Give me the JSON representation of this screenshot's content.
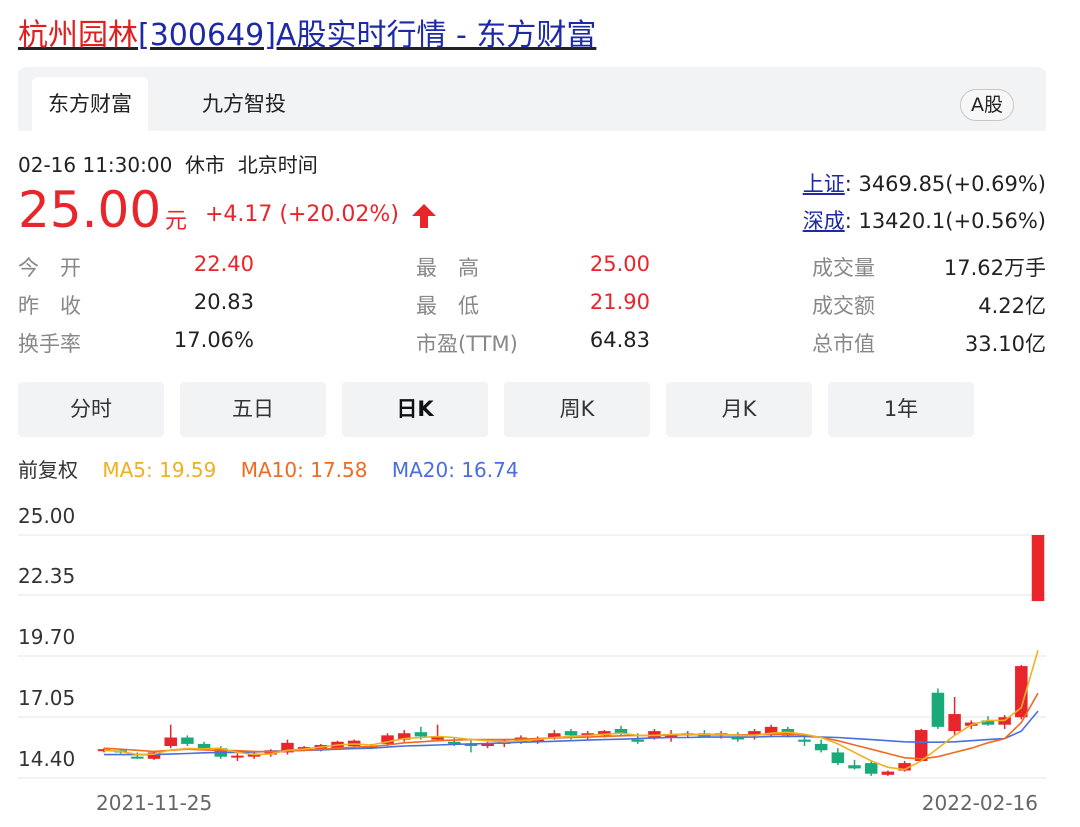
{
  "page": {
    "title_name": "杭州园林",
    "title_rest": "[300649]A股实时行情 - 东方财富"
  },
  "tabs": [
    {
      "label": "东方财富",
      "active": true
    },
    {
      "label": "九方智投",
      "active": false
    }
  ],
  "market_badge": "A股",
  "quote": {
    "time": "02-16 11:30:00",
    "status": "休市",
    "timezone": "北京时间",
    "price": "25.00",
    "unit": "元",
    "change": "+4.17 (+20.02%)",
    "direction_icon": "up-arrow-icon"
  },
  "indices": [
    {
      "label": "上证",
      "value": ": 3469.85(+0.69%)"
    },
    {
      "label": "深成",
      "value": ": 13420.1(+0.56%)"
    }
  ],
  "stats": [
    {
      "label": "今　开",
      "value": "22.40",
      "color": "red"
    },
    {
      "label": "最　高",
      "value": "25.00",
      "color": "red"
    },
    {
      "label": "成交量",
      "value": "17.62万手",
      "color": "dark"
    },
    {
      "label": "昨　收",
      "value": "20.83",
      "color": "dark"
    },
    {
      "label": "最　低",
      "value": "21.90",
      "color": "red"
    },
    {
      "label": "成交额",
      "value": "4.22亿",
      "color": "dark"
    },
    {
      "label": "换手率",
      "value": "17.06%",
      "color": "dark"
    },
    {
      "label": "市盈(TTM)",
      "value": "64.83",
      "color": "dark"
    },
    {
      "label": "总市值",
      "value": "33.10亿",
      "color": "dark"
    }
  ],
  "period_tabs": [
    {
      "label": "分时",
      "active": false
    },
    {
      "label": "五日",
      "active": false
    },
    {
      "label": "日K",
      "active": true
    },
    {
      "label": "周K",
      "active": false
    },
    {
      "label": "月K",
      "active": false
    },
    {
      "label": "1年",
      "active": false
    }
  ],
  "ma": {
    "adjust": "前复权",
    "ma5": "MA5: 19.59",
    "ma10": "MA10: 17.58",
    "ma20": "MA20: 16.74"
  },
  "colors": {
    "up": "#e8252a",
    "down": "#1aaa7a",
    "ma5": "#f0b020",
    "ma10": "#f06a20",
    "ma20": "#4a6ee0",
    "link": "#1d2aa8"
  },
  "chart_data": {
    "type": "candlestick",
    "y_ticks": [
      "25.00",
      "22.35",
      "19.70",
      "17.05",
      "14.40"
    ],
    "ylim": [
      13.6,
      25.0
    ],
    "x_labels": [
      "2021-11-25",
      "2022-02-16"
    ],
    "grid": true,
    "candles": [
      [
        14.9,
        15.0,
        14.8,
        14.95
      ],
      [
        14.9,
        14.95,
        14.75,
        14.8
      ],
      [
        14.6,
        14.8,
        14.5,
        14.55
      ],
      [
        14.5,
        14.85,
        14.45,
        14.8
      ],
      [
        15.1,
        16.1,
        15.0,
        15.5
      ],
      [
        15.5,
        15.6,
        15.1,
        15.2
      ],
      [
        15.2,
        15.3,
        14.9,
        15.0
      ],
      [
        15.0,
        15.1,
        14.5,
        14.6
      ],
      [
        14.6,
        14.75,
        14.4,
        14.65
      ],
      [
        14.6,
        14.8,
        14.5,
        14.75
      ],
      [
        14.7,
        14.95,
        14.6,
        14.9
      ],
      [
        14.8,
        15.4,
        14.7,
        15.25
      ],
      [
        14.95,
        15.1,
        14.85,
        15.05
      ],
      [
        14.9,
        15.2,
        14.85,
        15.15
      ],
      [
        15.0,
        15.35,
        14.95,
        15.3
      ],
      [
        15.1,
        15.4,
        15.05,
        15.35
      ],
      [
        15.0,
        15.2,
        14.95,
        15.1
      ],
      [
        15.2,
        15.7,
        15.1,
        15.6
      ],
      [
        15.4,
        15.85,
        15.3,
        15.7
      ],
      [
        15.75,
        16.0,
        15.4,
        15.55
      ],
      [
        15.4,
        16.1,
        15.35,
        15.5
      ],
      [
        15.3,
        15.5,
        15.1,
        15.25
      ],
      [
        15.2,
        15.45,
        14.8,
        15.1
      ],
      [
        15.1,
        15.3,
        15.0,
        15.2
      ],
      [
        15.2,
        15.4,
        15.05,
        15.35
      ],
      [
        15.3,
        15.6,
        15.2,
        15.5
      ],
      [
        15.3,
        15.55,
        15.2,
        15.45
      ],
      [
        15.5,
        15.85,
        15.4,
        15.7
      ],
      [
        15.8,
        15.9,
        15.4,
        15.6
      ],
      [
        15.6,
        15.8,
        15.4,
        15.7
      ],
      [
        15.6,
        15.85,
        15.5,
        15.8
      ],
      [
        15.9,
        16.05,
        15.6,
        15.7
      ],
      [
        15.4,
        15.7,
        15.2,
        15.3
      ],
      [
        15.5,
        15.9,
        15.4,
        15.8
      ],
      [
        15.5,
        15.85,
        15.3,
        15.6
      ],
      [
        15.6,
        15.8,
        15.5,
        15.7
      ],
      [
        15.7,
        15.85,
        15.5,
        15.55
      ],
      [
        15.6,
        15.8,
        15.45,
        15.7
      ],
      [
        15.5,
        15.75,
        15.3,
        15.45
      ],
      [
        15.6,
        15.9,
        15.4,
        15.8
      ],
      [
        15.7,
        16.1,
        15.5,
        16.0
      ],
      [
        15.9,
        16.0,
        15.5,
        15.6
      ],
      [
        15.4,
        15.6,
        15.1,
        15.3
      ],
      [
        15.2,
        15.4,
        14.8,
        14.9
      ],
      [
        14.8,
        15.0,
        14.2,
        14.3
      ],
      [
        14.2,
        14.45,
        14.0,
        14.05
      ],
      [
        14.3,
        14.4,
        13.7,
        13.8
      ],
      [
        13.75,
        13.95,
        13.7,
        13.9
      ],
      [
        13.95,
        14.4,
        13.9,
        14.3
      ],
      [
        14.4,
        15.9,
        14.4,
        15.85
      ],
      [
        17.6,
        17.8,
        15.9,
        16.0
      ],
      [
        15.8,
        17.4,
        15.6,
        16.6
      ],
      [
        16.05,
        16.3,
        15.9,
        16.2
      ],
      [
        16.3,
        16.5,
        16.05,
        16.1
      ],
      [
        16.1,
        16.55,
        15.9,
        16.45
      ],
      [
        16.45,
        18.9,
        16.35,
        18.85
      ],
      [
        21.9,
        25.0,
        21.9,
        25.0
      ]
    ],
    "ma5": [
      14.9,
      14.85,
      14.7,
      14.72,
      14.92,
      14.98,
      14.97,
      15.0,
      14.8,
      14.7,
      14.73,
      14.9,
      14.96,
      15.05,
      15.15,
      15.2,
      15.15,
      15.3,
      15.45,
      15.5,
      15.55,
      15.5,
      15.4,
      15.35,
      15.3,
      15.35,
      15.4,
      15.5,
      15.55,
      15.6,
      15.65,
      15.7,
      15.6,
      15.6,
      15.65,
      15.65,
      15.65,
      15.65,
      15.6,
      15.6,
      15.7,
      15.75,
      15.65,
      15.5,
      15.2,
      14.8,
      14.4,
      14.1,
      14.0,
      14.4,
      15.0,
      15.6,
      16.1,
      16.3,
      16.3,
      16.9,
      19.59
    ],
    "ma10": [
      15.0,
      14.95,
      14.9,
      14.85,
      14.9,
      14.95,
      14.92,
      14.9,
      14.88,
      14.85,
      14.83,
      14.87,
      14.9,
      14.95,
      15.0,
      15.05,
      15.08,
      15.15,
      15.25,
      15.3,
      15.35,
      15.38,
      15.4,
      15.4,
      15.4,
      15.42,
      15.45,
      15.48,
      15.5,
      15.52,
      15.55,
      15.58,
      15.6,
      15.6,
      15.62,
      15.63,
      15.63,
      15.62,
      15.62,
      15.63,
      15.65,
      15.66,
      15.62,
      15.5,
      15.35,
      15.15,
      14.95,
      14.75,
      14.55,
      14.5,
      14.6,
      14.8,
      15.0,
      15.25,
      15.45,
      16.2,
      17.58
    ],
    "ma20": [
      14.7,
      14.7,
      14.7,
      14.7,
      14.72,
      14.75,
      14.78,
      14.8,
      14.8,
      14.82,
      14.85,
      14.88,
      14.9,
      14.92,
      14.95,
      14.98,
      15.0,
      15.05,
      15.1,
      15.12,
      15.15,
      15.18,
      15.2,
      15.22,
      15.25,
      15.28,
      15.3,
      15.32,
      15.35,
      15.38,
      15.4,
      15.42,
      15.45,
      15.48,
      15.5,
      15.5,
      15.52,
      15.52,
      15.52,
      15.52,
      15.55,
      15.55,
      15.55,
      15.52,
      15.5,
      15.45,
      15.4,
      15.35,
      15.3,
      15.28,
      15.28,
      15.3,
      15.35,
      15.4,
      15.45,
      15.8,
      16.74
    ]
  }
}
